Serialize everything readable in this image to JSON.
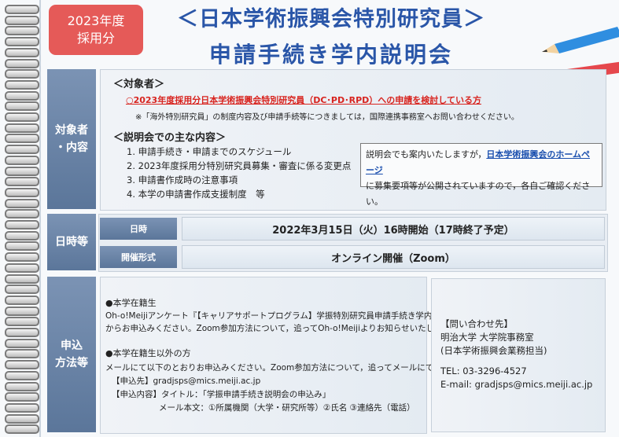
{
  "header": {
    "year_line1": "2023年度",
    "year_line2": "採用分",
    "title_line1": "＜日本学術振興会特別研究員＞",
    "title_line2": "申請手続き学内説明会"
  },
  "sections": {
    "target_label_1": "対象者",
    "target_label_2": "・内容",
    "datetime_label": "日時等",
    "apply_label_1": "申込",
    "apply_label_2": "方法等"
  },
  "target": {
    "heading": "＜対象者＞",
    "red_line": "○2023年度採用分日本学術振興会特別研究員（DC･PD･RPD）への申請を検討している方",
    "note": "※「海外特別研究員」の制度内容及び申請手続等につきましては，国際連携事務室へお問い合わせください。",
    "content_heading": "＜説明会での主な内容＞",
    "items": [
      "1. 申請手続き・申請までのスケジュール",
      "2. 2023年度採用分特別研究員募集・審査に係る変更点",
      "3. 申請書作成時の注意事項",
      "4. 本学の申請書作成支援制度　等"
    ],
    "info_pre": "説明会でも案内いたしますが，",
    "info_link": "日本学術振興会のホームページ",
    "info_post": "に募集要項等が公開されていますので，各自ご確認ください。"
  },
  "datetime": {
    "date_label": "日時",
    "date_value": "2022年3月15日（火）16時開始（17時終了予定）",
    "format_label": "開催形式",
    "format_value": "オンライン開催（Zoom）"
  },
  "apply": {
    "enrolled_heading": "●本学在籍生",
    "enrolled_line1": "Oh-o!Meijiアンケート『【キャリアサポートプログラム】学振特別研究員申請手続き学内説明会』",
    "enrolled_line2": "からお申込みください。Zoom参加方法について，追ってOh-o!Meijiよりお知らせいたします。",
    "other_heading": "●本学在籍生以外の方",
    "other_line1": "メールにて以下のとおりお申込みください。Zoom参加方法について，追ってメールにてご連絡します。",
    "other_line2": "【申込先】gradjsps@mics.meiji.ac.jp",
    "other_line3": "【申込内容】タイトル：「学振申請手続き説明会の申込み」",
    "other_line4": "メール本文：①所属機関（大学・研究所等）②氏名 ③連絡先（電話）"
  },
  "contact": {
    "heading": "【問い合わせ先】",
    "line1": "明治大学 大学院事務室",
    "line2": "(日本学術振興会業務担当)",
    "tel": "TEL: 03-3296-4527",
    "email": " E-mail: gradjsps@mics.meiji.ac.jp"
  },
  "colors": {
    "accent_blue": "#2a56a8",
    "badge_red": "#e55a58",
    "label_bg": "#6a84a8",
    "alert_red": "#d8241f"
  }
}
